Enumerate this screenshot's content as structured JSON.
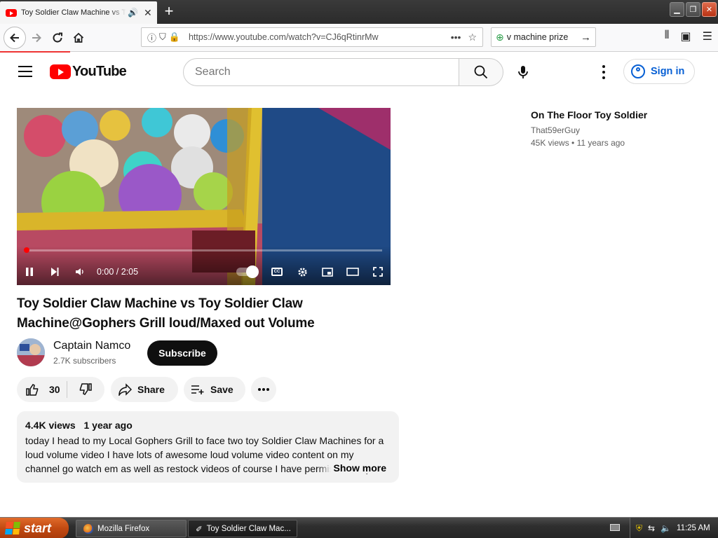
{
  "browser": {
    "tab_title": "Toy Soldier Claw Machine vs Toy Soldier Claw Machine@Gophers Grill loud/Maxed out Volume",
    "url": "https://www.youtube.com/watch?v=CJ6qRtinrMw",
    "search_value": "v machine prize"
  },
  "youtube": {
    "logo_text": "YouTube",
    "search_placeholder": "Search",
    "sign_in": "Sign in"
  },
  "player": {
    "time": "0:00 / 2:05",
    "progress": 0.0
  },
  "video": {
    "title": "Toy Soldier Claw Machine vs Toy Soldier Claw Machine@Gophers Grill loud/Maxed out Volume",
    "channel": "Captain Namco",
    "subscribers": "2.7K subscribers",
    "subscribe": "Subscribe",
    "likes": "30",
    "share": "Share",
    "save": "Save",
    "views": "4.4K views",
    "age": "1 year ago",
    "description": "today I head to my Local Gophers Grill to face two toy Soldier Claw Machines for a loud volume video I have lots of awesome loud volume video content on my channel go watch em as well as restock videos of course I have permission to post",
    "show_more": "Show more"
  },
  "recommended": [
    {
      "title": "On The Floor Toy Soldier",
      "channel": "That59erGuy",
      "views": "45K views",
      "age": "11 years ago"
    }
  ],
  "taskbar": {
    "start": "start",
    "task1": "Mozilla Firefox",
    "task2": "Toy Soldier Claw Mac...",
    "clock": "11:25 AM"
  }
}
